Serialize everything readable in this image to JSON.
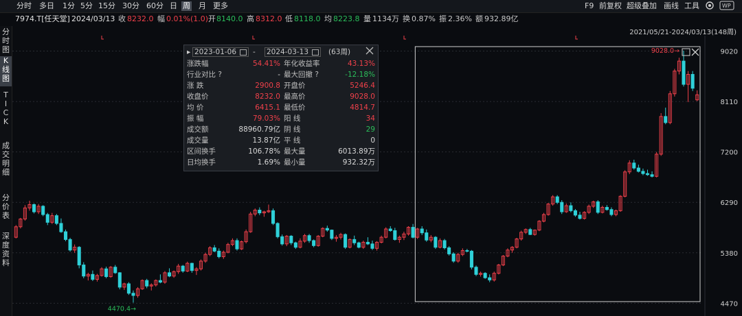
{
  "toolbar": {
    "periods": [
      "分时",
      "多日",
      "1分",
      "5分",
      "15分",
      "30分",
      "60分",
      "日",
      "周",
      "月",
      "更多"
    ],
    "active_period": "周",
    "right_buttons": [
      "F9",
      "前复权",
      "超级叠加",
      "画线",
      "工具"
    ]
  },
  "info": {
    "stock": "7974.T[任天堂]",
    "date": "2024/03/13",
    "close_label": "收",
    "close": "8232.0",
    "change_label": "幅",
    "change": "0.01%(1.0)",
    "open_label": "开",
    "open": "8140.0",
    "high_label": "高",
    "high": "8312.0",
    "low_label": "低",
    "low": "8118.0",
    "avg_label": "均",
    "avg": "8223.8",
    "volume_label": "量",
    "volume": "1134万",
    "turnover_label": "换",
    "turnover": "0.87%",
    "amplitude_label": "振",
    "amplitude": "2.36%",
    "amount_label": "额",
    "amount": "932.89亿"
  },
  "sidebar": [
    "分时图",
    "K线图",
    "TICK",
    "成交明细",
    "分价表",
    "深度资料"
  ],
  "range_label": "2021/05/21-2024/03/13(148周)",
  "popup": {
    "start_date": "2023-01-06",
    "end_date": "2024-03-13",
    "sep": "-",
    "weeks": "(63周)",
    "rows": [
      {
        "l1": "涨跌幅",
        "v1": "54.41%",
        "c1": "red",
        "l2": "年化收益率",
        "v2": "43.13%",
        "c2": "red"
      },
      {
        "l1": "行业对比 ?",
        "v1": "-",
        "c1": "white",
        "l2": "最大回撤 ?",
        "v2": "-12.18%",
        "c2": "green"
      },
      {
        "l1": "涨    跌",
        "v1": "2900.8",
        "c1": "red",
        "l2": "开盘价",
        "v2": "5246.4",
        "c2": "red"
      },
      {
        "l1": "收盘价",
        "v1": "8232.0",
        "c1": "red",
        "l2": "最高价",
        "v2": "9028.0",
        "c2": "red"
      },
      {
        "l1": "均    价",
        "v1": "6415.1",
        "c1": "red",
        "l2": "最低价",
        "v2": "4814.7",
        "c2": "red"
      },
      {
        "l1": "振    幅",
        "v1": "79.03%",
        "c1": "red",
        "l2": "阳    线",
        "v2": "34",
        "c2": "red"
      },
      {
        "l1": "成交额",
        "v1": "88960.79亿",
        "c1": "white",
        "l2": "阴    线",
        "v2": "29",
        "c2": "green"
      },
      {
        "l1": "成交量",
        "v1": "13.87亿",
        "c1": "white",
        "l2": "平    线",
        "v2": "0",
        "c2": "white"
      },
      {
        "l1": "区间换手",
        "v1": "106.78%",
        "c1": "white",
        "l2": "最大量",
        "v2": "6013.89万",
        "c2": "white"
      },
      {
        "l1": "日均换手",
        "v1": "1.69%",
        "c1": "white",
        "l2": "最小量",
        "v2": "932.32万",
        "c2": "white"
      }
    ]
  },
  "colors": {
    "up": "#f0404a",
    "down": "#2fd0d8",
    "grid": "#2a2d33",
    "bg": "#0a0c10"
  },
  "chart_data": {
    "type": "candlestick",
    "period": "weekly",
    "ylim": [
      4400,
      9200
    ],
    "y_ticks": [
      9020,
      8110,
      7200,
      6290,
      5380,
      4470
    ],
    "high_annotation": "9028.0",
    "low_annotation": "4470.4",
    "selection": {
      "start": "2023-01-06",
      "end": "2024-03-13"
    },
    "candles": [
      [
        5660,
        5880,
        5640,
        5850
      ],
      [
        5850,
        6010,
        5820,
        5990
      ],
      [
        5990,
        6240,
        5960,
        6190
      ],
      [
        6190,
        6320,
        6140,
        6250
      ],
      [
        6250,
        6270,
        6090,
        6120
      ],
      [
        6120,
        6260,
        6080,
        6220
      ],
      [
        6220,
        6240,
        6040,
        6070
      ],
      [
        6070,
        6100,
        5880,
        5930
      ],
      [
        5930,
        6100,
        5900,
        6050
      ],
      [
        6050,
        6080,
        5880,
        5910
      ],
      [
        5910,
        6000,
        5740,
        5760
      ],
      [
        5760,
        5800,
        5590,
        5620
      ],
      [
        5620,
        5650,
        5400,
        5430
      ],
      [
        5430,
        5530,
        5380,
        5480
      ],
      [
        5480,
        5500,
        5100,
        5160
      ],
      [
        5160,
        5210,
        4920,
        4960
      ],
      [
        4960,
        5020,
        4880,
        4990
      ],
      [
        4990,
        5060,
        4870,
        4900
      ],
      [
        4900,
        5000,
        4860,
        4970
      ],
      [
        4970,
        5120,
        4950,
        5090
      ],
      [
        5090,
        5130,
        4920,
        4950
      ],
      [
        4950,
        5140,
        4930,
        5120
      ],
      [
        5120,
        5160,
        5000,
        5020
      ],
      [
        5020,
        5030,
        4720,
        4760
      ],
      [
        4760,
        4840,
        4710,
        4820
      ],
      [
        4820,
        4850,
        4620,
        4650
      ],
      [
        4650,
        4700,
        4480,
        4610
      ],
      [
        4610,
        4760,
        4570,
        4730
      ],
      [
        4730,
        4900,
        4710,
        4880
      ],
      [
        4880,
        4910,
        4740,
        4780
      ],
      [
        4780,
        4830,
        4700,
        4800
      ],
      [
        4800,
        4900,
        4770,
        4880
      ],
      [
        4880,
        4990,
        4830,
        4850
      ],
      [
        4850,
        5050,
        4820,
        5020
      ],
      [
        5020,
        5100,
        4940,
        4960
      ],
      [
        4960,
        5060,
        4930,
        5040
      ],
      [
        5040,
        5180,
        5000,
        5140
      ],
      [
        5140,
        5160,
        5020,
        5050
      ],
      [
        5050,
        5220,
        5030,
        5190
      ],
      [
        5190,
        5200,
        5020,
        5060
      ],
      [
        5060,
        5120,
        4980,
        5090
      ],
      [
        5090,
        5260,
        5060,
        5230
      ],
      [
        5230,
        5380,
        5200,
        5350
      ],
      [
        5350,
        5500,
        5320,
        5470
      ],
      [
        5470,
        5520,
        5390,
        5410
      ],
      [
        5410,
        5460,
        5280,
        5310
      ],
      [
        5310,
        5420,
        5270,
        5390
      ],
      [
        5390,
        5560,
        5370,
        5530
      ],
      [
        5530,
        5640,
        5500,
        5600
      ],
      [
        5600,
        5640,
        5420,
        5450
      ],
      [
        5450,
        5600,
        5430,
        5580
      ],
      [
        5580,
        5800,
        5550,
        5760
      ],
      [
        5760,
        6120,
        5740,
        6080
      ],
      [
        6080,
        6180,
        6040,
        6150
      ],
      [
        6150,
        6200,
        6060,
        6100
      ],
      [
        6100,
        6140,
        6030,
        6120
      ],
      [
        6120,
        6250,
        6100,
        6140
      ],
      [
        6140,
        6180,
        5880,
        5910
      ],
      [
        5910,
        5930,
        5640,
        5670
      ],
      [
        5670,
        5710,
        5510,
        5540
      ],
      [
        5540,
        5700,
        5500,
        5680
      ],
      [
        5680,
        5700,
        5520,
        5560
      ],
      [
        5560,
        5580,
        5450,
        5480
      ],
      [
        5480,
        5640,
        5460,
        5590
      ],
      [
        5590,
        5720,
        5560,
        5690
      ],
      [
        5690,
        5720,
        5560,
        5600
      ],
      [
        5600,
        5620,
        5480,
        5510
      ],
      [
        5510,
        5700,
        5490,
        5680
      ],
      [
        5680,
        5840,
        5660,
        5820
      ],
      [
        5820,
        5870,
        5760,
        5790
      ],
      [
        5790,
        5800,
        5610,
        5640
      ],
      [
        5640,
        5700,
        5580,
        5660
      ],
      [
        5660,
        5740,
        5620,
        5710
      ],
      [
        5710,
        5730,
        5450,
        5480
      ],
      [
        5480,
        5640,
        5460,
        5620
      ],
      [
        5620,
        5690,
        5520,
        5560
      ],
      [
        5560,
        5580,
        5460,
        5480
      ],
      [
        5480,
        5600,
        5450,
        5570
      ],
      [
        5570,
        5660,
        5520,
        5540
      ],
      [
        5540,
        5600,
        5430,
        5460
      ],
      [
        5460,
        5590,
        5420,
        5570
      ],
      [
        5570,
        5690,
        5550,
        5660
      ],
      [
        5660,
        5840,
        5640,
        5810
      ],
      [
        5810,
        5860,
        5760,
        5780
      ],
      [
        5780,
        5830,
        5600,
        5620
      ],
      [
        5620,
        5690,
        5560,
        5660
      ],
      [
        5660,
        5760,
        5610,
        5720
      ],
      [
        5720,
        5860,
        5690,
        5840
      ],
      [
        5840,
        5900,
        5640,
        5660
      ],
      [
        5660,
        5830,
        5630,
        5810
      ],
      [
        5810,
        5860,
        5700,
        5740
      ],
      [
        5740,
        5800,
        5580,
        5610
      ],
      [
        5610,
        5700,
        5570,
        5660
      ],
      [
        5660,
        5680,
        5450,
        5480
      ],
      [
        5480,
        5640,
        5460,
        5600
      ],
      [
        5600,
        5630,
        5440,
        5470
      ],
      [
        5470,
        5500,
        5330,
        5360
      ],
      [
        5360,
        5390,
        5200,
        5230
      ],
      [
        5230,
        5380,
        5200,
        5350
      ],
      [
        5350,
        5460,
        5320,
        5420
      ],
      [
        5420,
        5450,
        5390,
        5410
      ],
      [
        5410,
        5430,
        5080,
        5120
      ],
      [
        5120,
        5150,
        4960,
        4990
      ],
      [
        4990,
        5040,
        4950,
        5010
      ],
      [
        5010,
        5030,
        4910,
        4930
      ],
      [
        4930,
        4990,
        4850,
        4890
      ],
      [
        4890,
        5040,
        4860,
        5010
      ],
      [
        5010,
        5180,
        4990,
        5160
      ],
      [
        5160,
        5340,
        5140,
        5320
      ],
      [
        5320,
        5460,
        5300,
        5430
      ],
      [
        5430,
        5500,
        5380,
        5480
      ],
      [
        5480,
        5650,
        5460,
        5630
      ],
      [
        5630,
        5780,
        5600,
        5750
      ],
      [
        5750,
        5820,
        5720,
        5800
      ],
      [
        5800,
        5830,
        5700,
        5710
      ],
      [
        5710,
        5800,
        5690,
        5790
      ],
      [
        5790,
        5970,
        5770,
        5950
      ],
      [
        5950,
        6100,
        5930,
        6070
      ],
      [
        6070,
        6280,
        6050,
        6260
      ],
      [
        6260,
        6420,
        6230,
        6390
      ],
      [
        6390,
        6420,
        6260,
        6290
      ],
      [
        6290,
        6330,
        6080,
        6120
      ],
      [
        6120,
        6270,
        6100,
        6230
      ],
      [
        6230,
        6290,
        6110,
        6140
      ],
      [
        6140,
        6170,
        6030,
        6060
      ],
      [
        6060,
        6120,
        5980,
        6000
      ],
      [
        6000,
        6130,
        5980,
        6110
      ],
      [
        6110,
        6250,
        6080,
        6220
      ],
      [
        6220,
        6320,
        6190,
        6300
      ],
      [
        6300,
        6330,
        6080,
        6110
      ],
      [
        6110,
        6230,
        6090,
        6200
      ],
      [
        6200,
        6240,
        6140,
        6160
      ],
      [
        6160,
        6200,
        6040,
        6070
      ],
      [
        6070,
        6160,
        6040,
        6140
      ],
      [
        6140,
        6420,
        6120,
        6400
      ],
      [
        6400,
        6870,
        6380,
        6840
      ],
      [
        6840,
        7050,
        6800,
        7000
      ],
      [
        7000,
        7060,
        6880,
        6910
      ],
      [
        6910,
        6970,
        6830,
        6850
      ],
      [
        6850,
        6900,
        6780,
        6810
      ],
      [
        6810,
        6880,
        6770,
        6790
      ],
      [
        6790,
        6850,
        6740,
        6760
      ],
      [
        6760,
        7200,
        6740,
        7160
      ],
      [
        7160,
        7900,
        7130,
        7840
      ],
      [
        7840,
        8000,
        7700,
        7730
      ],
      [
        7730,
        8300,
        7700,
        8250
      ],
      [
        8250,
        8700,
        8200,
        8660
      ],
      [
        8660,
        8900,
        8600,
        8840
      ],
      [
        8840,
        9028,
        8380,
        8420
      ],
      [
        8420,
        8660,
        8100,
        8600
      ],
      [
        8600,
        8660,
        8300,
        8350
      ],
      [
        8140,
        8312,
        8118,
        8232
      ]
    ]
  }
}
